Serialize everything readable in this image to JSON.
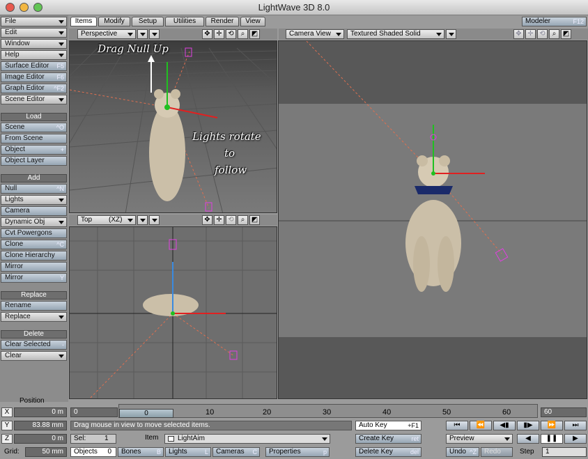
{
  "window": {
    "title": "LightWave 3D 8.0"
  },
  "menu": {
    "file": "File",
    "edit": "Edit",
    "window": "Window",
    "help": "Help",
    "surface_editor": "Surface Editor",
    "surface_editor_sc": "F5",
    "image_editor": "Image Editor",
    "image_editor_sc": "F6",
    "graph_editor": "Graph Editor",
    "graph_editor_sc": "^F2",
    "scene_editor": "Scene Editor",
    "load_hdr": "Load",
    "scene": "Scene",
    "scene_sc": "^O",
    "from_scene": "From Scene",
    "object": "Object",
    "object_sc": "+",
    "object_layer": "Object Layer",
    "add_hdr": "Add",
    "null": "Null",
    "null_sc": "^N",
    "lights": "Lights",
    "camera": "Camera",
    "dynamic_obj": "Dynamic Obj",
    "cvt_powergons": "Cvt Powergons",
    "clone": "Clone",
    "clone_sc": "^C",
    "clone_hierarchy": "Clone Hierarchy",
    "mirror1": "Mirror",
    "mirror2": "Mirror",
    "mirror2_sc": "Y",
    "replace_hdr": "Replace",
    "rename": "Rename",
    "replace": "Replace",
    "delete_hdr": "Delete",
    "clear_selected": "Clear Selected",
    "clear_selected_sc": "-",
    "clear": "Clear"
  },
  "tabs": [
    "Items",
    "Modify",
    "Setup",
    "Utilities",
    "Render",
    "View"
  ],
  "modeler": {
    "label": "Modeler",
    "shortcut": "F12"
  },
  "viewports": {
    "tl": {
      "view": "Perspective",
      "annot1": "Drag Null Up",
      "annot2a": "Lights rotate",
      "annot2b": "to",
      "annot2c": "follow"
    },
    "bl": {
      "view": "Top",
      "axes": "(XZ)"
    },
    "right": {
      "view": "Camera View",
      "render": "Textured Shaded Solid"
    }
  },
  "bottom": {
    "position_label": "Position",
    "x_label": "X",
    "x_val": "0 m",
    "y_label": "Y",
    "y_val": "83.88 mm",
    "z_label": "Z",
    "z_val": "0 m",
    "grid_label": "Grid:",
    "grid_val": "50 mm",
    "frame_start": "0",
    "frame_current": "0",
    "frame_end": "60",
    "ticks": [
      "0",
      "10",
      "20",
      "30",
      "40",
      "50",
      "60"
    ],
    "status": "Drag mouse in view to move selected items.",
    "sel_label": "Sel:",
    "sel_val": "1",
    "item_label": "Item",
    "item_val": "LightAim",
    "objects_label": "Objects",
    "objects_val": "0",
    "bones_label": "Bones",
    "bones_sc": "B",
    "lights_label": "Lights",
    "lights_sc": "L",
    "cameras_label": "Cameras",
    "cameras_sc": "C",
    "properties_label": "Properties",
    "properties_sc": "p",
    "auto_key": "Auto Key",
    "auto_key_sc": "+F1",
    "create_key": "Create Key",
    "create_key_sc": "ret",
    "delete_key": "Delete Key",
    "delete_key_sc": "del",
    "preview": "Preview",
    "undo": "Undo",
    "undo_sc": "^Z",
    "redo": "Redo",
    "step_label": "Step",
    "step_val": "1"
  },
  "colors": {
    "bg": "#9b9b9b",
    "viewport": "#6b6b6b",
    "grid": "#555555",
    "light": "#e040e0",
    "x_axis": "#e02020",
    "y_axis": "#20c020",
    "z_axis": "#3a8ae0"
  }
}
